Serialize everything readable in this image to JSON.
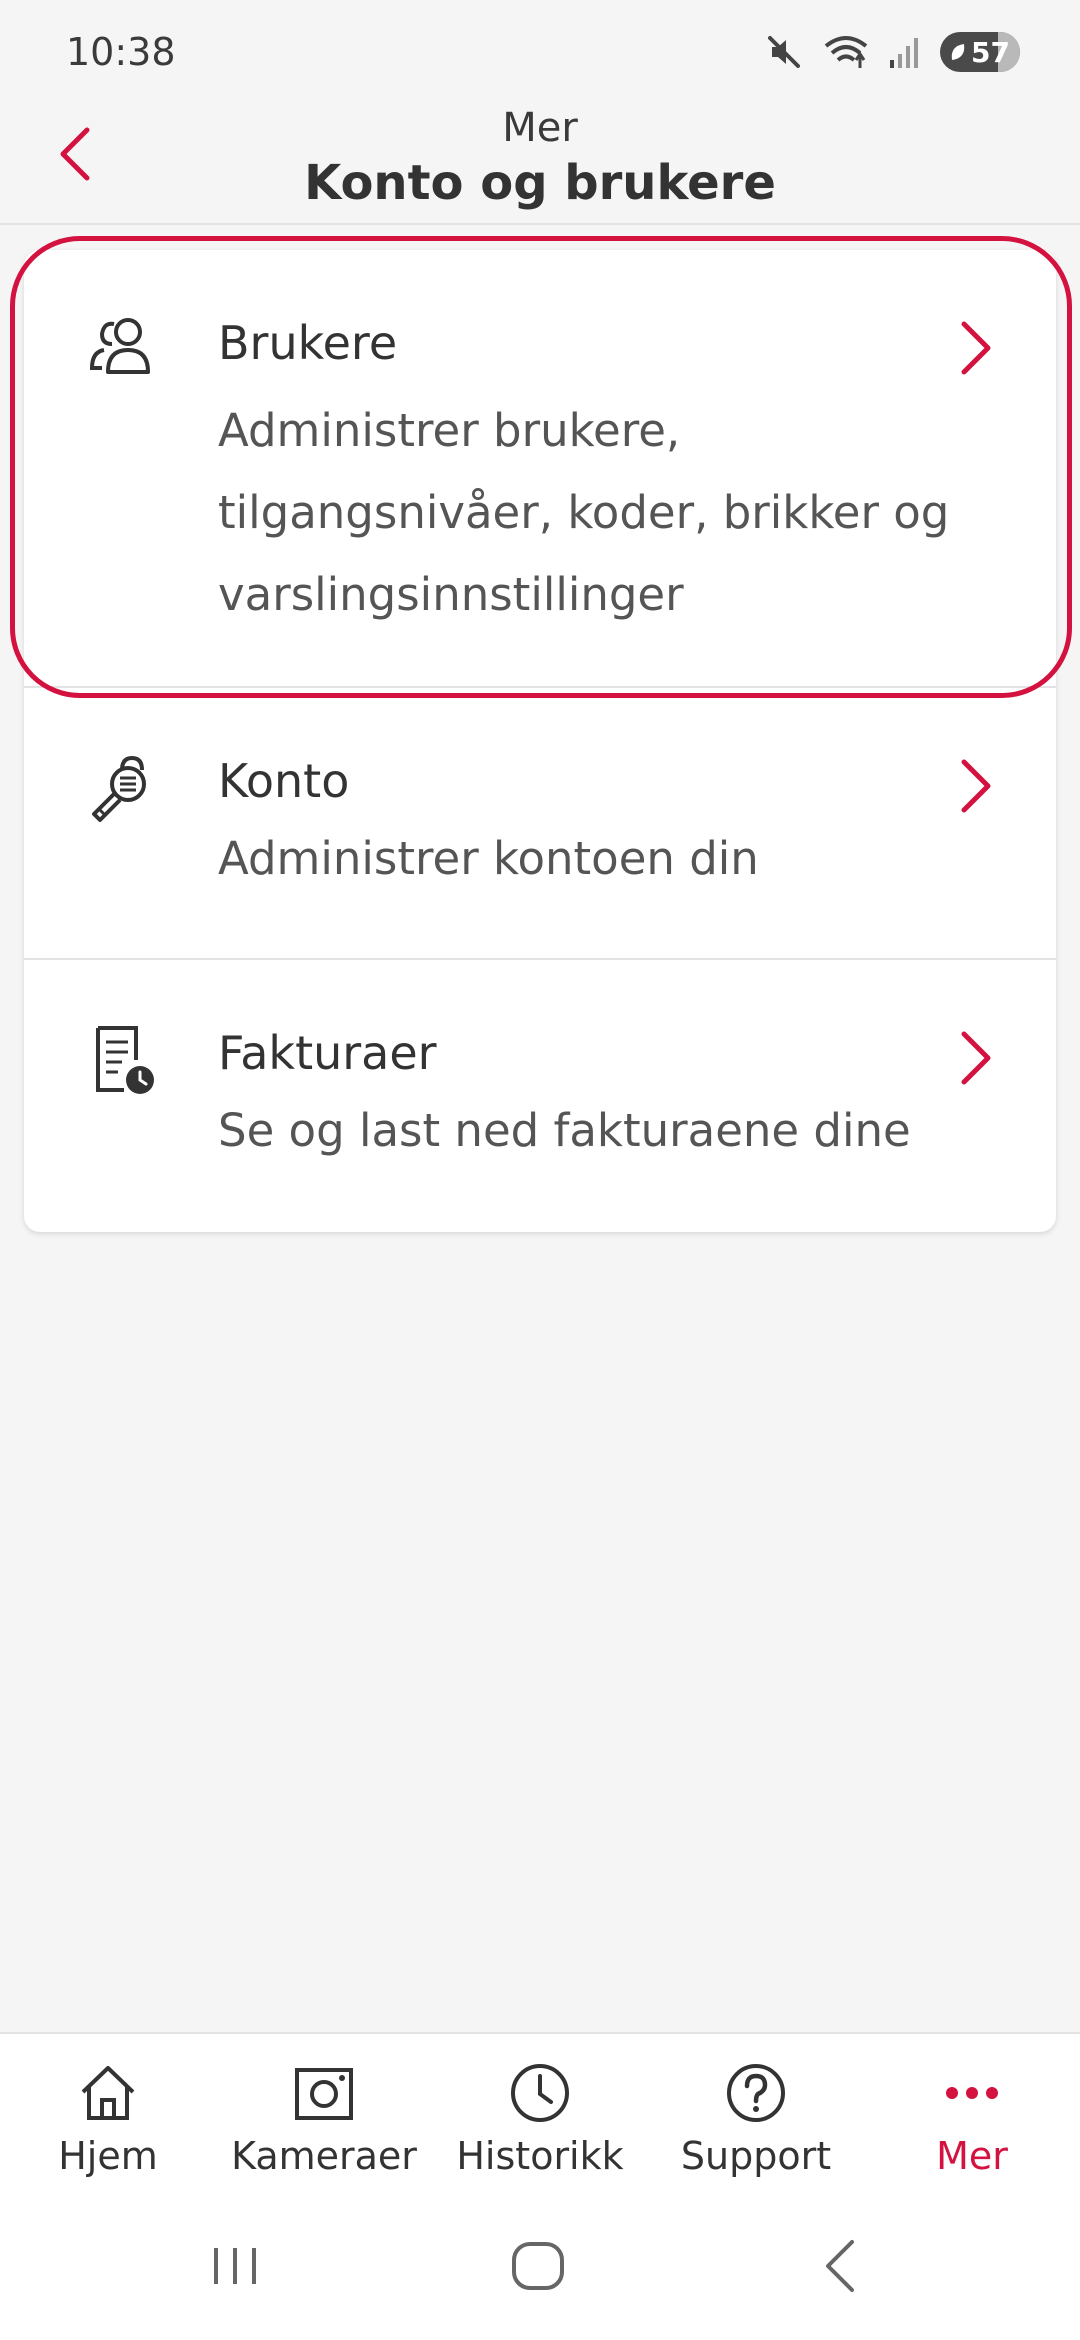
{
  "status_bar": {
    "time": "10:38",
    "battery": "57"
  },
  "header": {
    "subtitle": "Mer",
    "title": "Konto og brukere"
  },
  "menu": [
    {
      "title": "Brukere",
      "description_lines": [
        "Administrer brukere,",
        "tilgangsnivåer, koder, brikker og",
        "varslingsinnstillinger"
      ],
      "icon": "users-icon"
    },
    {
      "title": "Konto",
      "description_lines": [
        "Administrer kontoen din"
      ],
      "icon": "account-key-icon"
    },
    {
      "title": "Fakturaer",
      "description_lines": [
        "Se og last ned fakturaene dine"
      ],
      "icon": "invoice-clock-icon"
    }
  ],
  "bottom_nav": [
    {
      "label": "Hjem",
      "icon": "home-icon"
    },
    {
      "label": "Kameraer",
      "icon": "camera-icon"
    },
    {
      "label": "Historikk",
      "icon": "clock-icon"
    },
    {
      "label": "Support",
      "icon": "help-icon"
    },
    {
      "label": "Mer",
      "icon": "more-dots-icon",
      "active": true
    }
  ],
  "colors": {
    "accent": "#d4123f",
    "background": "#f5f5f5",
    "card": "#ffffff",
    "text": "#333333"
  }
}
